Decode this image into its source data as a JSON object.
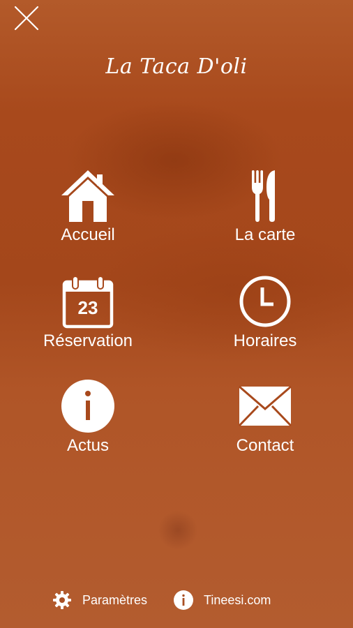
{
  "brand": {
    "title": "La Taca D'oli"
  },
  "menu": {
    "items": [
      {
        "label": "Accueil",
        "icon": "home-icon"
      },
      {
        "label": "La carte",
        "icon": "fork-knife-icon"
      },
      {
        "label": "Réservation",
        "icon": "calendar-icon",
        "calendar_day": "23"
      },
      {
        "label": "Horaires",
        "icon": "clock-icon"
      },
      {
        "label": "Actus",
        "icon": "info-icon"
      },
      {
        "label": "Contact",
        "icon": "envelope-icon"
      }
    ]
  },
  "footer": {
    "settings_label": "Paramètres",
    "settings_icon": "gear-icon",
    "provider_label": "Tineesi.com",
    "provider_icon": "info-icon"
  },
  "colors": {
    "background": "#a8491c",
    "foreground": "#ffffff"
  }
}
